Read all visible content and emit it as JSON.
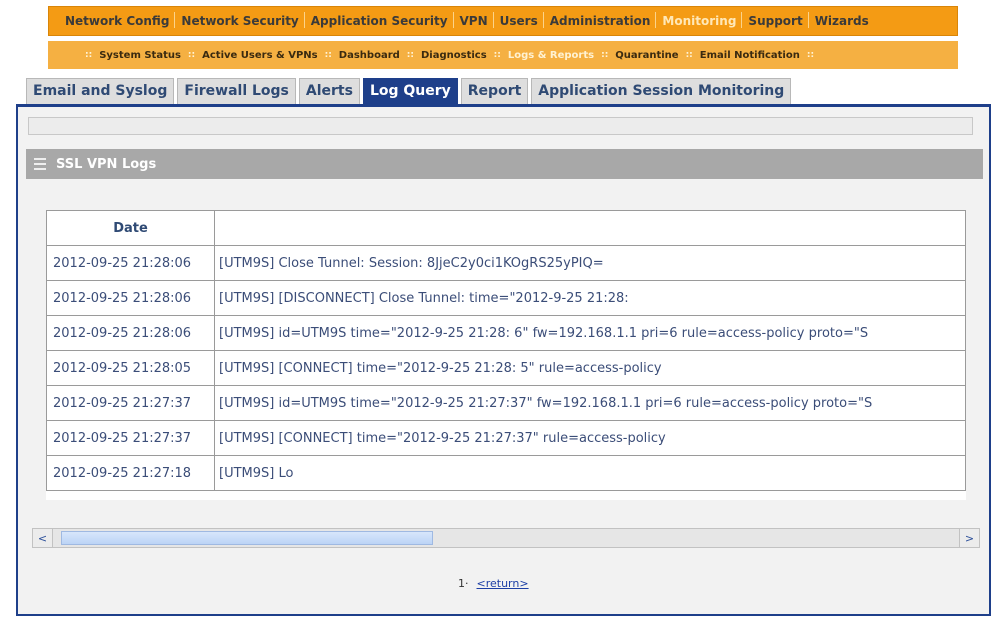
{
  "top_nav": {
    "items": [
      {
        "label": "Network Config",
        "active": false
      },
      {
        "label": "Network Security",
        "active": false
      },
      {
        "label": "Application Security",
        "active": false
      },
      {
        "label": "VPN",
        "active": false
      },
      {
        "label": "Users",
        "active": false
      },
      {
        "label": "Administration",
        "active": false
      },
      {
        "label": "Monitoring",
        "active": true
      },
      {
        "label": "Support",
        "active": false
      },
      {
        "label": "Wizards",
        "active": false
      }
    ]
  },
  "sub_nav": {
    "items": [
      {
        "label": "System Status",
        "active": false
      },
      {
        "label": "Active Users & VPNs",
        "active": false
      },
      {
        "label": "Dashboard",
        "active": false
      },
      {
        "label": "Diagnostics",
        "active": false
      },
      {
        "label": "Logs & Reports",
        "active": true
      },
      {
        "label": "Quarantine",
        "active": false
      },
      {
        "label": "Email Notification",
        "active": false
      }
    ]
  },
  "tabs": {
    "items": [
      {
        "label": "Email and Syslog",
        "active": false
      },
      {
        "label": "Firewall Logs",
        "active": false
      },
      {
        "label": "Alerts",
        "active": false
      },
      {
        "label": "Log Query",
        "active": true
      },
      {
        "label": "Report",
        "active": false
      },
      {
        "label": "Application Session Monitoring",
        "active": false
      }
    ]
  },
  "section": {
    "title": "SSL VPN Logs"
  },
  "table": {
    "headers": [
      "Date",
      ""
    ],
    "rows": [
      {
        "date": "2012-09-25 21:28:06",
        "message": "[UTM9S] Close Tunnel: Session: 8JjeC2y0ci1KOgRS25yPIQ="
      },
      {
        "date": "2012-09-25 21:28:06",
        "message": "[UTM9S] [DISCONNECT] Close Tunnel: time=\"2012-9-25 21:28:"
      },
      {
        "date": "2012-09-25 21:28:06",
        "message": "[UTM9S] id=UTM9S time=\"2012-9-25 21:28: 6\" fw=192.168.1.1 pri=6 rule=access-policy proto=\"S"
      },
      {
        "date": "2012-09-25 21:28:05",
        "message": "[UTM9S] [CONNECT] time=\"2012-9-25 21:28: 5\" rule=access-policy"
      },
      {
        "date": "2012-09-25 21:27:37",
        "message": "[UTM9S] id=UTM9S time=\"2012-9-25 21:27:37\" fw=192.168.1.1 pri=6 rule=access-policy proto=\"S"
      },
      {
        "date": "2012-09-25 21:27:37",
        "message": "[UTM9S] [CONNECT] time=\"2012-9-25 21:27:37\" rule=access-policy"
      },
      {
        "date": "2012-09-25 21:27:18",
        "message": "[UTM9S] Lo"
      }
    ]
  },
  "scrollbar": {
    "left_arrow": "<",
    "right_arrow": ">"
  },
  "pager": {
    "page": "1·",
    "return_label": "<return>"
  }
}
